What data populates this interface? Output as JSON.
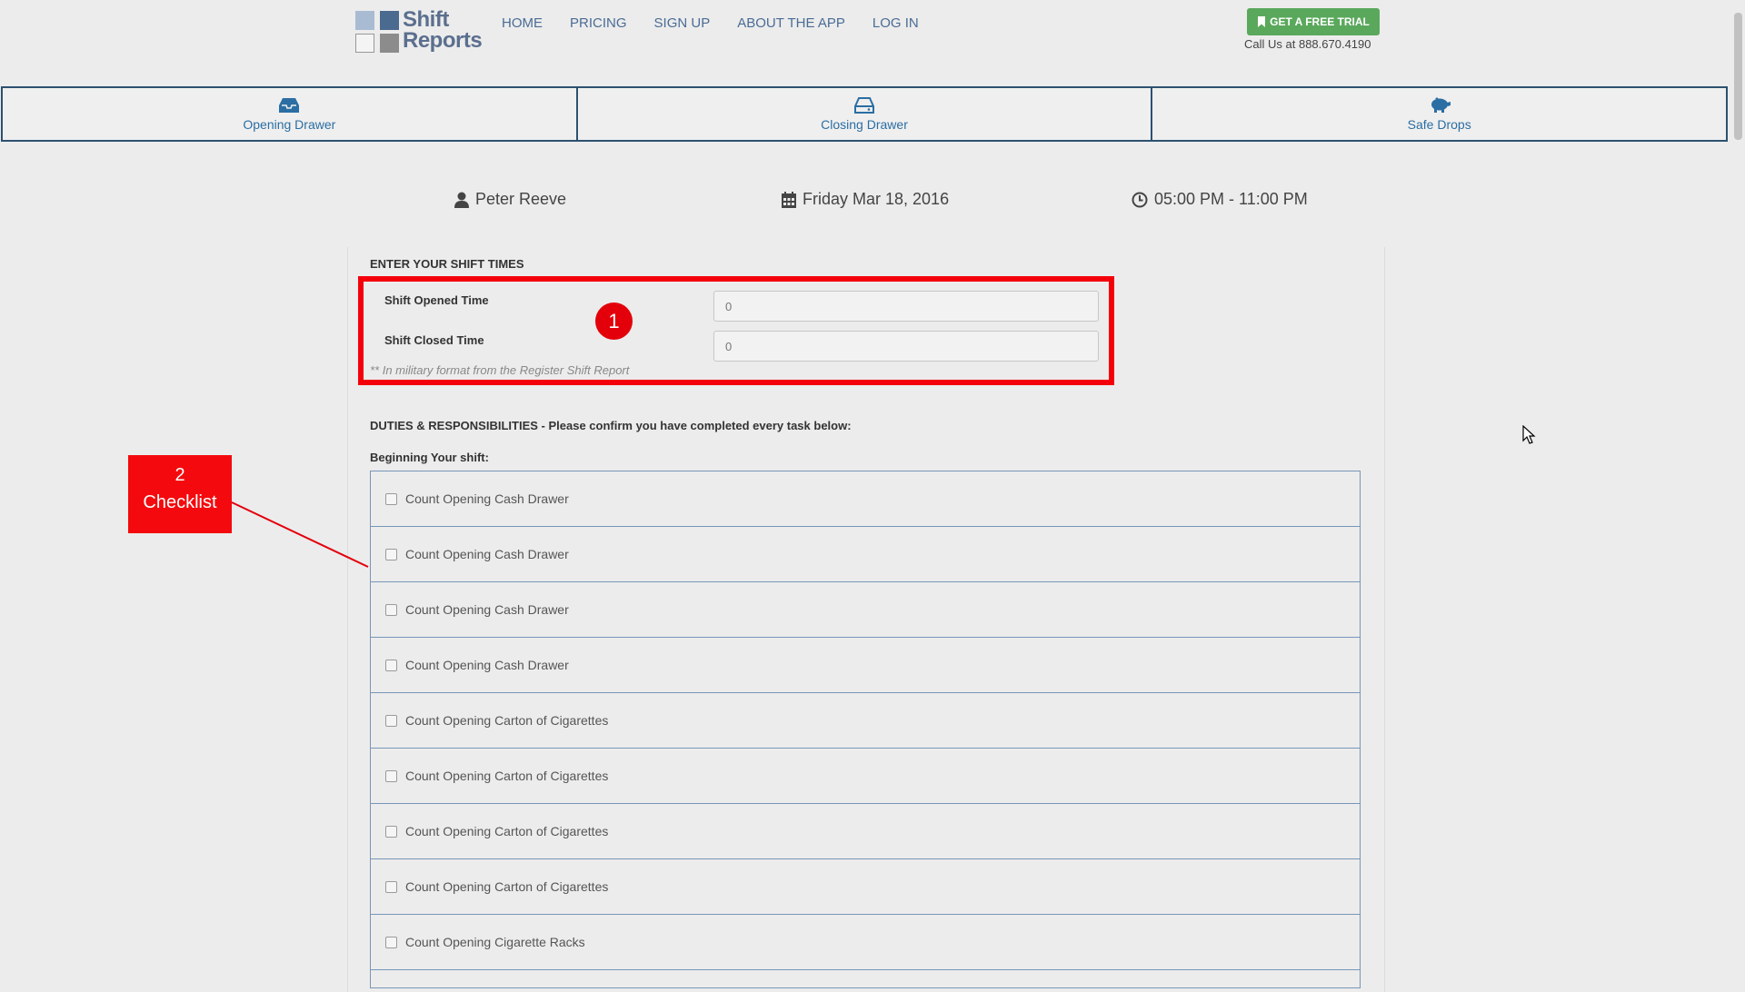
{
  "header": {
    "logo_line1": "Shift",
    "logo_line2": "Reports",
    "nav": [
      "HOME",
      "PRICING",
      "SIGN UP",
      "ABOUT THE APP",
      "LOG IN"
    ],
    "trial_label": "GET A FREE TRIAL",
    "call_text": "Call Us at 888.670.4190"
  },
  "tabs": [
    {
      "label": "Opening Drawer",
      "icon": "inbox-icon"
    },
    {
      "label": "Closing Drawer",
      "icon": "drive-icon"
    },
    {
      "label": "Safe Drops",
      "icon": "piggy-bank-icon"
    }
  ],
  "info": {
    "user": "Peter Reeve",
    "date": "Friday Mar 18, 2016",
    "time": "05:00 PM - 11:00 PM"
  },
  "shift_times": {
    "heading": "ENTER YOUR SHIFT TIMES",
    "opened_label": "Shift Opened Time",
    "opened_value": "0",
    "closed_label": "Shift Closed Time",
    "closed_value": "0",
    "note": "** In military format from the Register Shift Report"
  },
  "duties": {
    "heading": "DUTIES & RESPONSIBILITIES - Please confirm you have completed every task below:",
    "subheading": "Beginning Your shift:",
    "items": [
      "Count Opening Cash Drawer",
      "Count Opening Cash Drawer",
      "Count Opening Cash Drawer",
      "Count Opening Cash Drawer",
      "Count Opening Carton of Cigarettes",
      "Count Opening Carton of Cigarettes",
      "Count Opening Carton of Cigarettes",
      "Count Opening Carton of Cigarettes",
      "Count Opening Cigarette Racks"
    ]
  },
  "annotations": {
    "badge1": "1",
    "callout_number": "2",
    "callout_label": "Checklist"
  },
  "colors": {
    "accent_red": "#f40a0e",
    "tab_text": "#2b6ea3",
    "trial_green": "#5aa85c"
  }
}
